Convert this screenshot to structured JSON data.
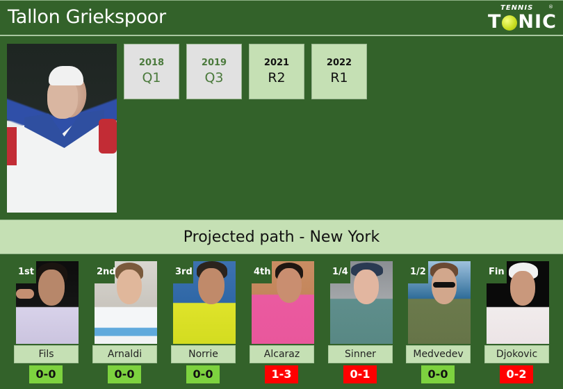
{
  "header": {
    "player_name": "Tallon Griekspoor",
    "logo": {
      "top_text": "TENNIS",
      "brand_left": "T",
      "brand_right": "NIC",
      "registered": "®",
      "ball_icon": "tennis-ball-icon"
    }
  },
  "player_photo": {
    "alt": "Tallon Griekspoor"
  },
  "history": [
    {
      "year": "2018",
      "result": "Q1",
      "style": "grey"
    },
    {
      "year": "2019",
      "result": "Q3",
      "style": "grey"
    },
    {
      "year": "2021",
      "result": "R2",
      "style": "green"
    },
    {
      "year": "2022",
      "result": "R1",
      "style": "green"
    }
  ],
  "banner": {
    "title": "Projected path - New York"
  },
  "path": [
    {
      "round": "1st",
      "name": "Fils",
      "h2h": "0-0",
      "h2h_status": "even"
    },
    {
      "round": "2nd",
      "name": "Arnaldi",
      "h2h": "0-0",
      "h2h_status": "even"
    },
    {
      "round": "3rd",
      "name": "Norrie",
      "h2h": "0-0",
      "h2h_status": "even"
    },
    {
      "round": "4th",
      "name": "Alcaraz",
      "h2h": "1-3",
      "h2h_status": "loss"
    },
    {
      "round": "1/4",
      "name": "Sinner",
      "h2h": "0-1",
      "h2h_status": "loss"
    },
    {
      "round": "1/2",
      "name": "Medvedev",
      "h2h": "0-0",
      "h2h_status": "even"
    },
    {
      "round": "Fin",
      "name": "Djokovic",
      "h2h": "0-2",
      "h2h_status": "loss"
    }
  ],
  "colors": {
    "background": "#33622a",
    "panel_light_green": "#c5e0b4",
    "panel_grey": "#e1e1e1",
    "h2h_even": "#7dd23f",
    "h2h_loss": "#ff0000"
  }
}
